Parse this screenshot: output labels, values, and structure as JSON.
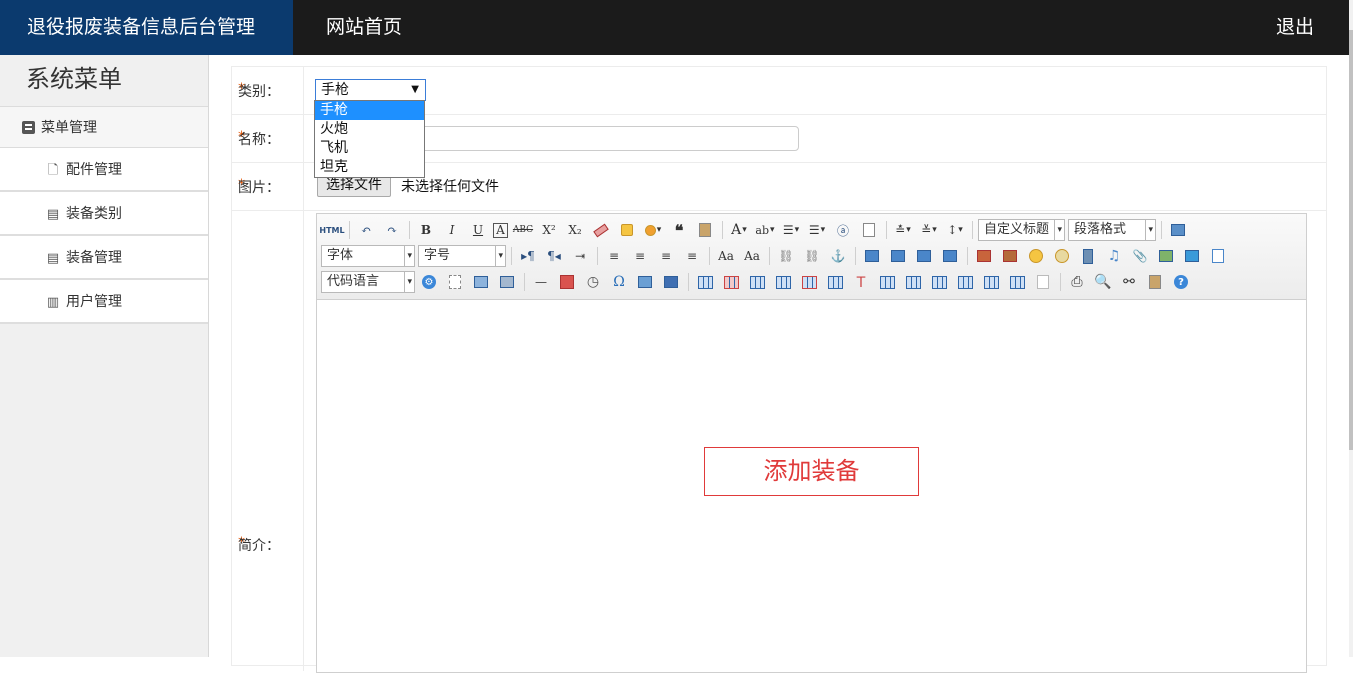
{
  "header": {
    "brand": "退役报废装备信息后台管理",
    "home_link": "网站首页",
    "logout_link": "退出"
  },
  "sidebar": {
    "title": "系统菜单",
    "menu_group": "菜单管理",
    "items": [
      {
        "label": "配件管理",
        "icon": "file-icon"
      },
      {
        "label": "装备类别",
        "icon": "list-icon"
      },
      {
        "label": "装备管理",
        "icon": "list-icon"
      },
      {
        "label": "用户管理",
        "icon": "books-icon"
      }
    ]
  },
  "form": {
    "required_mark": "*",
    "category": {
      "label": "类别：",
      "value": "手枪",
      "options": [
        "手枪",
        "火炮",
        "飞机",
        "坦克"
      ]
    },
    "name": {
      "label": "名称：",
      "value": ""
    },
    "image": {
      "label": "图片：",
      "button": "选择文件",
      "status": "未选择任何文件"
    },
    "intro": {
      "label": "简介：",
      "toolbar": {
        "html_label": "HTML",
        "custom_heading": "自定义标题",
        "paragraph_format": "段落格式",
        "font_family": "字体",
        "font_size": "字号",
        "code_language": "代码语言"
      }
    },
    "submit": "添加装备"
  },
  "colors": {
    "brand_bg": "#0b3a6e",
    "topbar_bg": "#1b1b1b",
    "required": "#e55300",
    "submit": "#e03a3a",
    "select_highlight": "#1e90ff"
  }
}
